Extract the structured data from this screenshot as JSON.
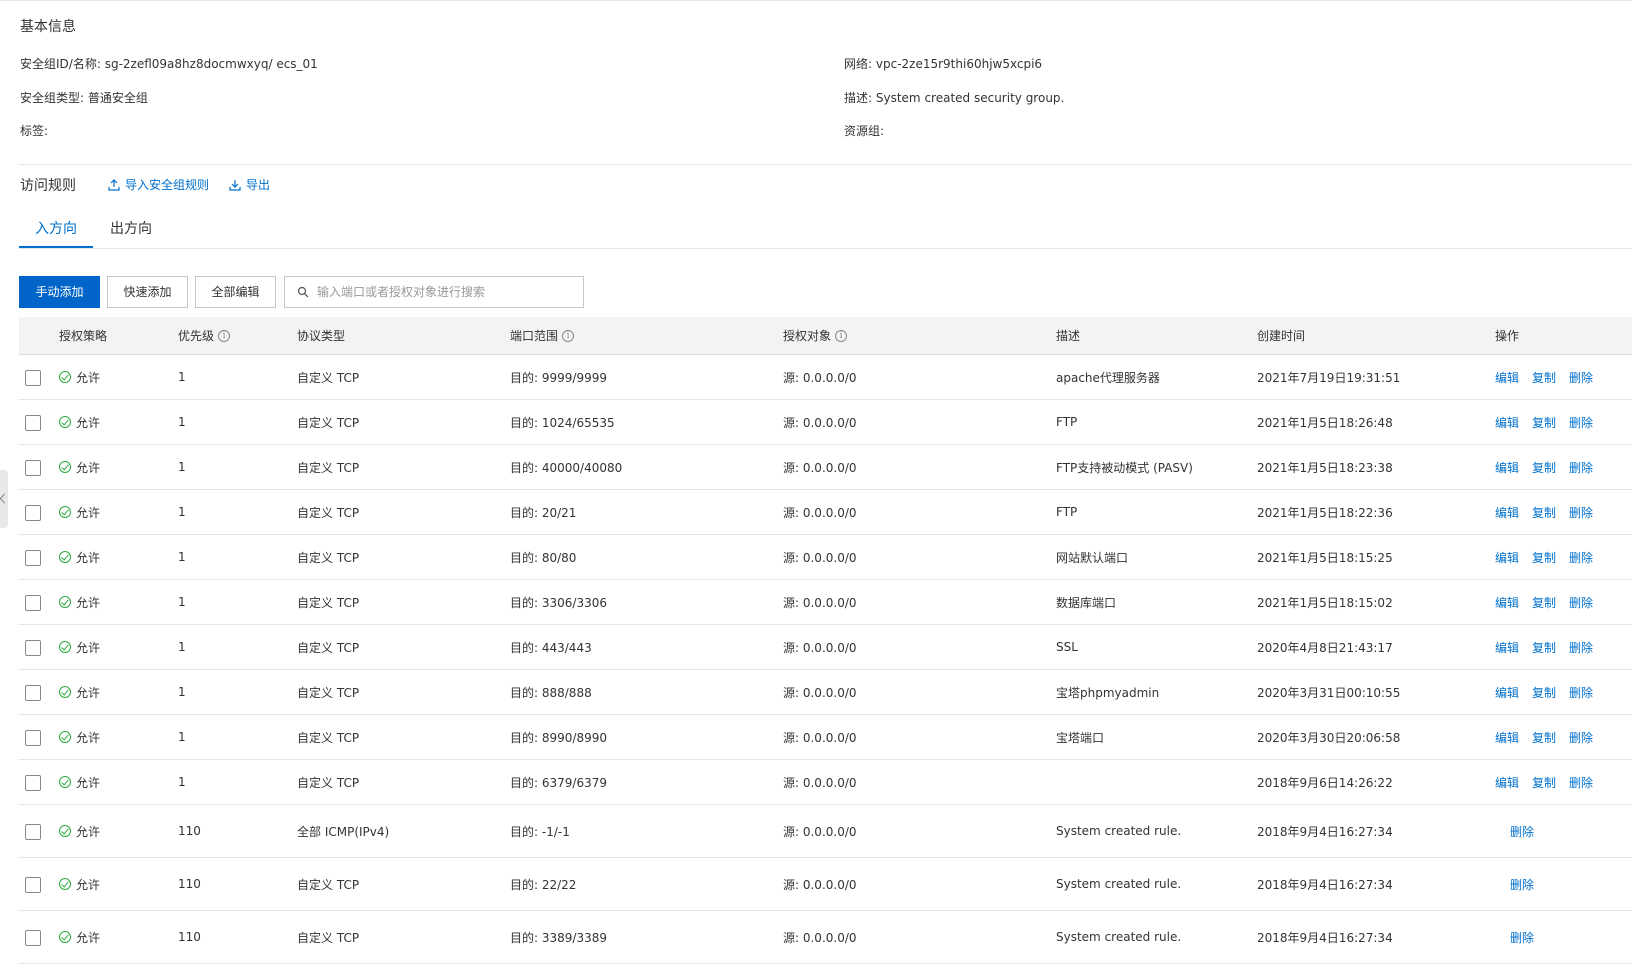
{
  "basic": {
    "title": "基本信息",
    "sg_id_label": "安全组ID/名称:",
    "sg_id_value": "sg-2zefl09a8hz8docmwxyq/ ecs_01",
    "sg_type_label": "安全组类型:",
    "sg_type_value": "普通安全组",
    "tags_label": "标签:",
    "network_label": "网络:",
    "network_value": "vpc-2ze15r9thi60hjw5xcpi6",
    "desc_label": "描述:",
    "desc_value": "System created security group.",
    "resource_group_label": "资源组:"
  },
  "rules": {
    "title": "访问规则",
    "import_label": "导入安全组规则",
    "export_label": "导出"
  },
  "tabs": [
    {
      "label": "入方向",
      "active": true
    },
    {
      "label": "出方向",
      "active": false
    }
  ],
  "toolbar": {
    "manual_add": "手动添加",
    "quick_add": "快速添加",
    "edit_all": "全部编辑",
    "search_placeholder": "输入端口或者授权对象进行搜索"
  },
  "table": {
    "headers": {
      "policy": "授权策略",
      "priority": "优先级",
      "protocol": "协议类型",
      "port": "端口范围",
      "target": "授权对象",
      "description": "描述",
      "created": "创建时间",
      "actions": "操作"
    },
    "action_labels": {
      "edit": "编辑",
      "copy": "复制",
      "delete": "删除"
    },
    "rows": [
      {
        "policy": "允许",
        "priority": "1",
        "protocol": "自定义 TCP",
        "port": "目的: 9999/9999",
        "target": "源: 0.0.0.0/0",
        "description": "apache代理服务器",
        "created": "2021年7月19日19:31:51",
        "full_actions": true
      },
      {
        "policy": "允许",
        "priority": "1",
        "protocol": "自定义 TCP",
        "port": "目的: 1024/65535",
        "target": "源: 0.0.0.0/0",
        "description": "FTP",
        "created": "2021年1月5日18:26:48",
        "full_actions": true
      },
      {
        "policy": "允许",
        "priority": "1",
        "protocol": "自定义 TCP",
        "port": "目的: 40000/40080",
        "target": "源: 0.0.0.0/0",
        "description": "FTP支持被动模式 (PASV)",
        "created": "2021年1月5日18:23:38",
        "full_actions": true
      },
      {
        "policy": "允许",
        "priority": "1",
        "protocol": "自定义 TCP",
        "port": "目的: 20/21",
        "target": "源: 0.0.0.0/0",
        "description": "FTP",
        "created": "2021年1月5日18:22:36",
        "full_actions": true
      },
      {
        "policy": "允许",
        "priority": "1",
        "protocol": "自定义 TCP",
        "port": "目的: 80/80",
        "target": "源: 0.0.0.0/0",
        "description": "网站默认端口",
        "created": "2021年1月5日18:15:25",
        "full_actions": true
      },
      {
        "policy": "允许",
        "priority": "1",
        "protocol": "自定义 TCP",
        "port": "目的: 3306/3306",
        "target": "源: 0.0.0.0/0",
        "description": "数据库端口",
        "created": "2021年1月5日18:15:02",
        "full_actions": true
      },
      {
        "policy": "允许",
        "priority": "1",
        "protocol": "自定义 TCP",
        "port": "目的: 443/443",
        "target": "源: 0.0.0.0/0",
        "description": "SSL",
        "created": "2020年4月8日21:43:17",
        "full_actions": true
      },
      {
        "policy": "允许",
        "priority": "1",
        "protocol": "自定义 TCP",
        "port": "目的: 888/888",
        "target": "源: 0.0.0.0/0",
        "description": "宝塔phpmyadmin",
        "created": "2020年3月31日00:10:55",
        "full_actions": true
      },
      {
        "policy": "允许",
        "priority": "1",
        "protocol": "自定义 TCP",
        "port": "目的: 8990/8990",
        "target": "源: 0.0.0.0/0",
        "description": "宝塔端口",
        "created": "2020年3月30日20:06:58",
        "full_actions": true
      },
      {
        "policy": "允许",
        "priority": "1",
        "protocol": "自定义 TCP",
        "port": "目的: 6379/6379",
        "target": "源: 0.0.0.0/0",
        "description": "",
        "created": "2018年9月6日14:26:22",
        "full_actions": true
      },
      {
        "policy": "允许",
        "priority": "110",
        "protocol": "全部 ICMP(IPv4)",
        "port": "目的: -1/-1",
        "target": "源: 0.0.0.0/0",
        "description": "System created rule.",
        "created": "2018年9月4日16:27:34",
        "full_actions": false
      },
      {
        "policy": "允许",
        "priority": "110",
        "protocol": "自定义 TCP",
        "port": "目的: 22/22",
        "target": "源: 0.0.0.0/0",
        "description": "System created rule.",
        "created": "2018年9月4日16:27:34",
        "full_actions": false
      },
      {
        "policy": "允许",
        "priority": "110",
        "protocol": "自定义 TCP",
        "port": "目的: 3389/3389",
        "target": "源: 0.0.0.0/0",
        "description": "System created rule.",
        "created": "2018年9月4日16:27:34",
        "full_actions": false
      }
    ]
  }
}
